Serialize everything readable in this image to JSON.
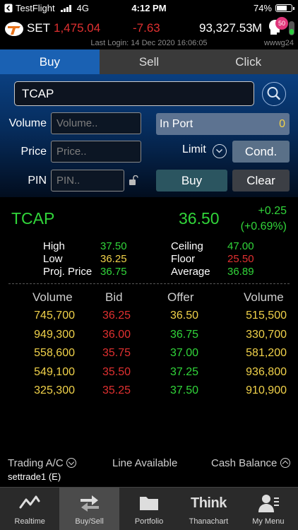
{
  "status_bar": {
    "back_app": "TestFlight",
    "network": "4G",
    "time": "4:12 PM",
    "battery": "74%",
    "battery_level": 0.74
  },
  "index": {
    "name": "SET",
    "value": "1,475.04",
    "change": "-7.63",
    "volume": "93,327.53",
    "unit": "M",
    "notification_count": "50",
    "last_login": "Last Login: 14 Dec 2020 16:06:05",
    "user_code": "wwwg24"
  },
  "tabs": [
    {
      "label": "Buy"
    },
    {
      "label": "Sell"
    },
    {
      "label": "Click"
    }
  ],
  "order_form": {
    "symbol": "TCAP",
    "volume_label": "Volume",
    "volume_placeholder": "Volume..",
    "price_label": "Price",
    "price_placeholder": "Price..",
    "pin_label": "PIN",
    "pin_placeholder": "PIN..",
    "inport_label": "In Port",
    "inport_value": "0",
    "limit_label": "Limit",
    "cond_label": "Cond.",
    "buy_label": "Buy",
    "clear_label": "Clear"
  },
  "quote": {
    "symbol": "TCAP",
    "last": "36.50",
    "change": "+0.25",
    "change_pct": "(+0.69%)",
    "high_label": "High",
    "high": "37.50",
    "low_label": "Low",
    "low": "36.25",
    "proj_label": "Proj. Price",
    "proj": "36.75",
    "ceiling_label": "Ceiling",
    "ceiling": "47.00",
    "floor_label": "Floor",
    "floor": "25.50",
    "average_label": "Average",
    "average": "36.89"
  },
  "depth": {
    "headers": {
      "bid_volume": "Volume",
      "bid": "Bid",
      "offer": "Offer",
      "offer_volume": "Volume"
    },
    "rows": [
      {
        "bid_volume": "745,700",
        "bid": "36.25",
        "offer": "36.50",
        "offer_volume": "515,500"
      },
      {
        "bid_volume": "949,300",
        "bid": "36.00",
        "offer": "36.75",
        "offer_volume": "330,700"
      },
      {
        "bid_volume": "558,600",
        "bid": "35.75",
        "offer": "37.00",
        "offer_volume": "581,200"
      },
      {
        "bid_volume": "549,100",
        "bid": "35.50",
        "offer": "37.25",
        "offer_volume": "936,800"
      },
      {
        "bid_volume": "325,300",
        "bid": "35.25",
        "offer": "37.50",
        "offer_volume": "910,900"
      }
    ]
  },
  "account": {
    "trading_label": "Trading A/C",
    "account_id": "settrade1 (E)",
    "line_available_label": "Line Available",
    "cash_balance_label": "Cash Balance"
  },
  "nav": [
    {
      "label": "Realtime",
      "icon": "line-chart-icon"
    },
    {
      "label": "Buy/Sell",
      "icon": "buy-sell-icon"
    },
    {
      "label": "Portfolio",
      "icon": "folder-icon"
    },
    {
      "label": "Thanachart",
      "icon": "think-logo-icon",
      "logo_text": "Think"
    },
    {
      "label": "My Menu",
      "icon": "user-menu-icon"
    }
  ],
  "colors": {
    "up": "#31d53a",
    "down": "#e03030",
    "unchanged": "#f1d24a",
    "accent": "#1a61b3"
  }
}
